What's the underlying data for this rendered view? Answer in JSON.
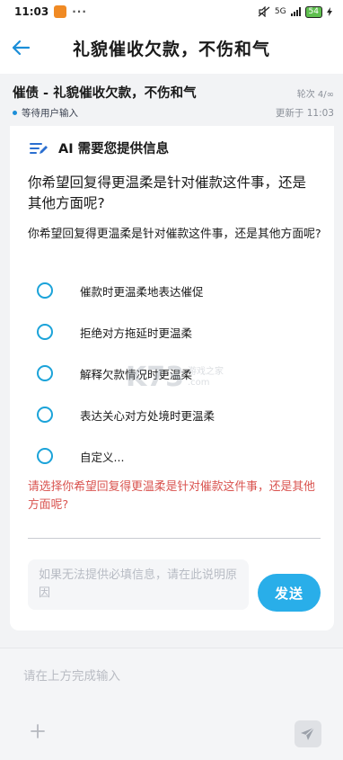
{
  "status_bar": {
    "time": "11:03",
    "network": "5G",
    "battery": "54"
  },
  "header": {
    "title": "礼貌催收欠款，不伤和气"
  },
  "session": {
    "title": "催债 - 礼貌催收欠款，不伤和气",
    "round": "轮次 4/∞",
    "status": "等待用户输入",
    "updated": "更新于 11:03"
  },
  "card": {
    "header_title": "AI 需要您提供信息",
    "question_big": "你希望回复得更温柔是针对催款这件事，还是其他方面呢?",
    "question_small": "你希望回复得更温柔是针对催款这件事，还是其他方面呢?",
    "options": [
      "催款时更温柔地表达催促",
      "拒绝对方拖延时更温柔",
      "解释欠款情况时更温柔",
      "表达关心对方处境时更温柔",
      "自定义..."
    ],
    "error": "请选择你希望回复得更温柔是针对催款这件事，还是其他方面呢?",
    "reason_placeholder": "如果无法提供必填信息，请在此说明原因",
    "send_label": "发送"
  },
  "bottom": {
    "input_placeholder": "请在上方完成输入"
  },
  "watermark": {
    "main": "K73",
    "sub1": "游戏之家",
    "sub2": ".com"
  },
  "colors": {
    "accent": "#1ba3d9",
    "send": "#29aee9",
    "error": "#d9534f",
    "back_arrow": "#1b8ed8"
  },
  "icons": {
    "back": "arrow-left-icon",
    "ai": "edit-lines-icon",
    "plus": "plus-icon",
    "send": "paper-plane-icon"
  }
}
